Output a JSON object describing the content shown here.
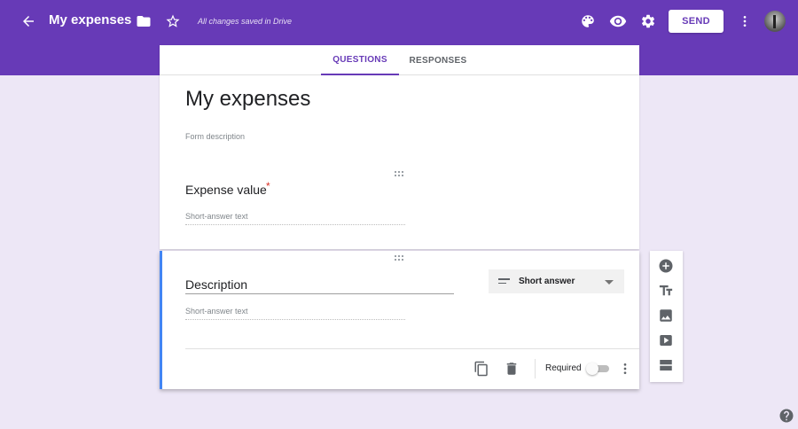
{
  "header": {
    "title": "My expenses",
    "saved_status": "All changes saved in Drive",
    "send_label": "SEND",
    "brand_color": "#673ab7"
  },
  "tabs": [
    {
      "label": "QUESTIONS",
      "active": true
    },
    {
      "label": "RESPONSES",
      "active": false
    }
  ],
  "form": {
    "title": "My expenses",
    "description_placeholder": "Form description"
  },
  "questions": [
    {
      "title": "Expense value",
      "required_marker": "*",
      "answer_placeholder": "Short-answer text"
    },
    {
      "title": "Description",
      "answer_placeholder": "Short-answer text",
      "type": "Short answer",
      "required_label": "Required",
      "required": false
    }
  ],
  "icons": {
    "header": [
      "back-arrow-icon",
      "folder-icon",
      "star-icon",
      "palette-icon",
      "preview-eye-icon",
      "settings-gear-icon",
      "more-vert-icon"
    ],
    "question_footer": [
      "duplicate-icon",
      "delete-icon",
      "more-vert-icon"
    ],
    "side_toolbar": [
      "add-question-icon",
      "add-title-icon",
      "add-image-icon",
      "add-video-icon",
      "add-section-icon"
    ],
    "help": "help-icon"
  }
}
